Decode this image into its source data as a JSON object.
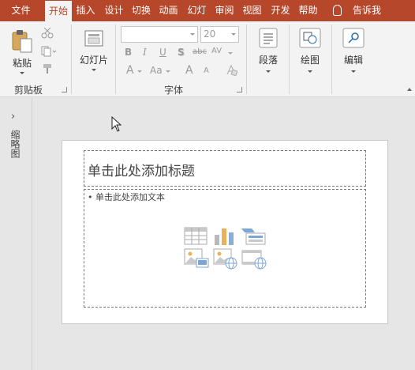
{
  "tabs": [
    {
      "label": "文件",
      "active": false
    },
    {
      "label": "开始",
      "active": true
    },
    {
      "label": "插入",
      "active": false
    },
    {
      "label": "设计",
      "active": false
    },
    {
      "label": "切换",
      "active": false
    },
    {
      "label": "动画",
      "active": false
    },
    {
      "label": "幻灯",
      "active": false
    },
    {
      "label": "审阅",
      "active": false
    },
    {
      "label": "视图",
      "active": false
    },
    {
      "label": "开发",
      "active": false
    },
    {
      "label": "帮助",
      "active": false
    }
  ],
  "tell_me": "告诉我",
  "ribbon": {
    "clipboard": {
      "paste_label": "粘贴",
      "group_label": "剪贴板"
    },
    "slides": {
      "new_slide_label": "幻灯片"
    },
    "font": {
      "group_label": "字体",
      "font_name_value": "",
      "font_size_value": "20",
      "bold": "B",
      "italic": "I",
      "underline": "U",
      "shadow": "S",
      "strike": "abc",
      "spacing": "AV",
      "grow": "A",
      "shrink": "A",
      "color": "A",
      "case": "Aa",
      "clear": "A"
    },
    "paragraph": {
      "label": "段落"
    },
    "drawing": {
      "label": "绘图"
    },
    "editing": {
      "label": "编辑"
    }
  },
  "left_pane": {
    "label": "缩略图"
  },
  "slide": {
    "title_placeholder": "单击此处添加标题",
    "body_placeholder": "• 单击此处添加文本"
  },
  "colors": {
    "accent": "#b7472a",
    "ribbon_bg": "#f3f3f3",
    "workspace_bg": "#e6e6e6"
  }
}
